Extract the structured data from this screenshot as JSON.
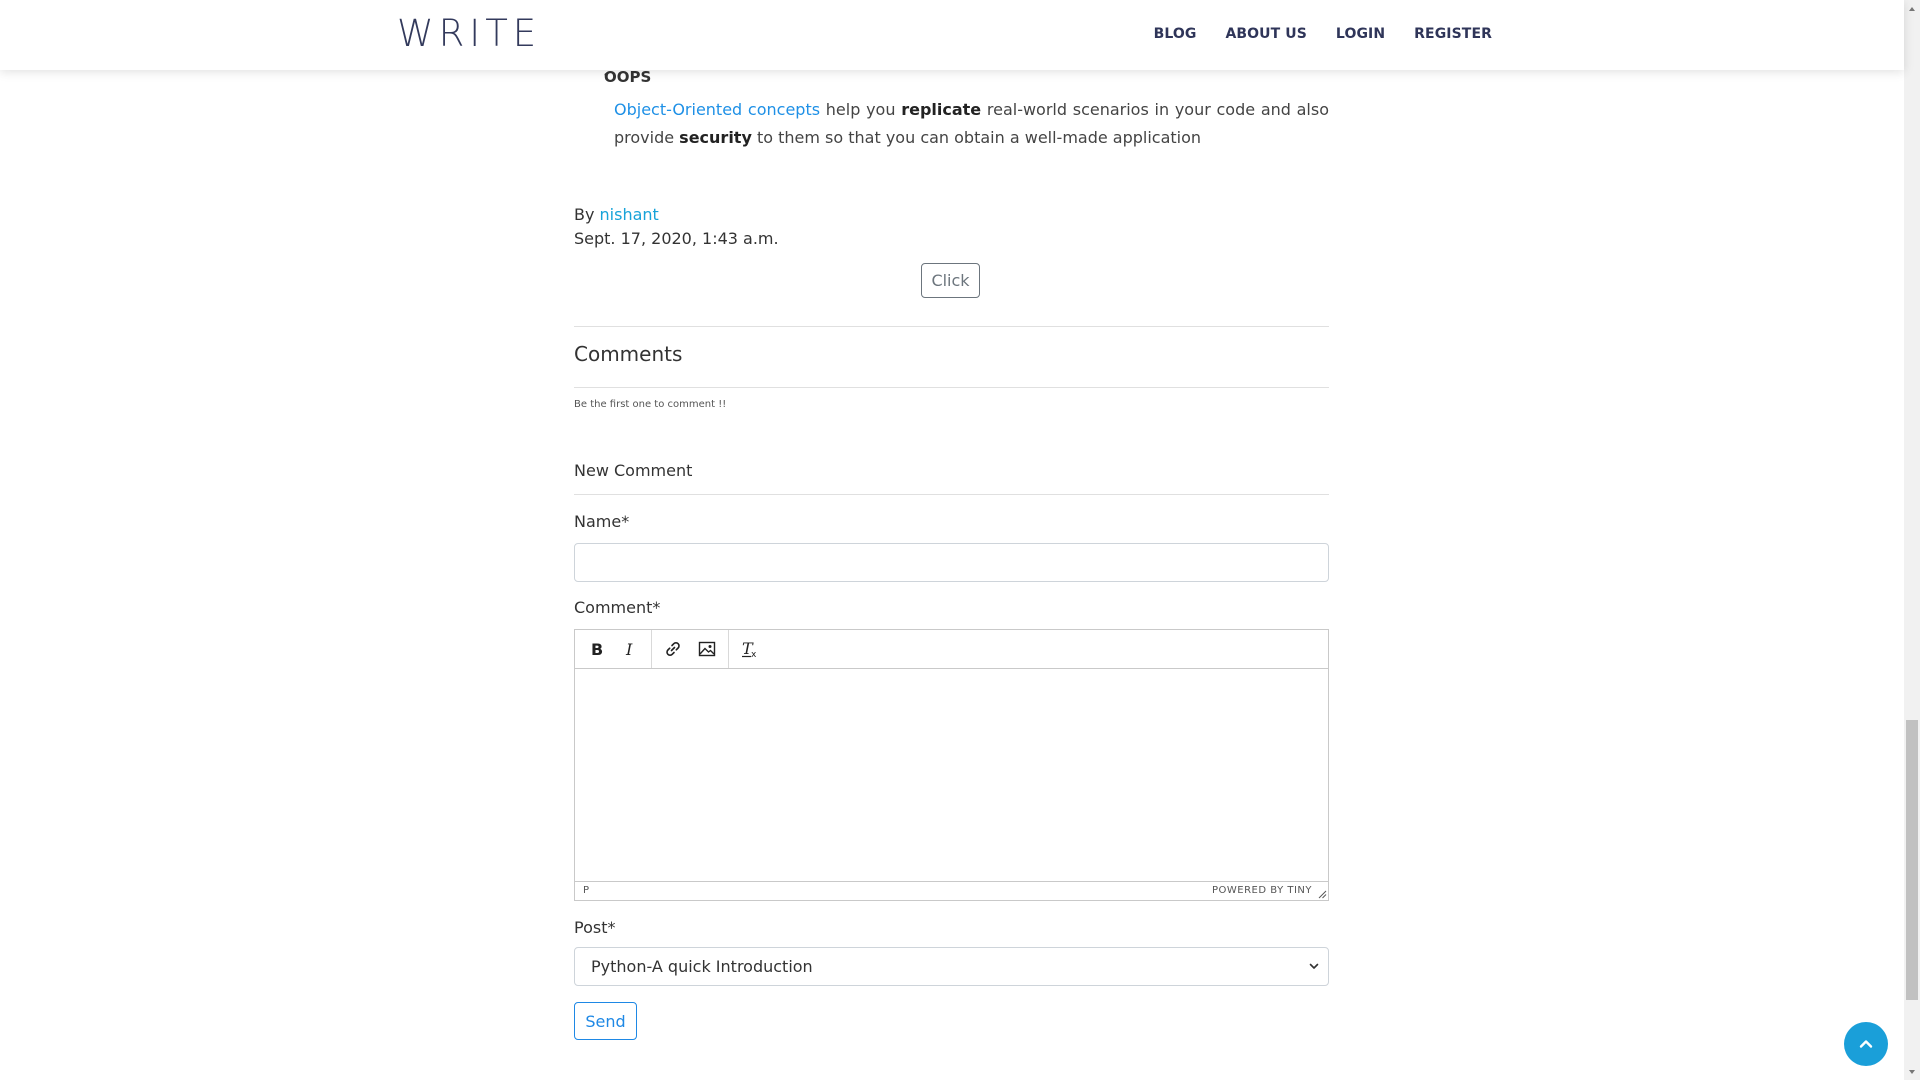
{
  "header": {
    "logo": "WRITE",
    "nav": [
      "BLOG",
      "ABOUT US",
      "LOGIN",
      "REGISTER"
    ]
  },
  "article": {
    "bullet_title": "OOPS",
    "bullet_link": "Object-Oriented concepts",
    "bullet_text_1": " help you ",
    "bullet_bold_1": "replicate",
    "bullet_text_2": " real-world scenarios in your code and also provide ",
    "bullet_bold_2": "security",
    "bullet_text_3": " to them so that you can obtain a well-made application",
    "by_label": "By ",
    "author": "nishant",
    "date": "Sept. 17, 2020, 1:43 a.m.",
    "click_label": "Click"
  },
  "comments": {
    "heading": "Comments",
    "empty_text": "Be the first one to comment !!",
    "new_heading": "New Comment",
    "name_label": "Name*",
    "name_value": "",
    "comment_label": "Comment*",
    "editor_status_tag": "P",
    "editor_powered": "POWERED BY TINY",
    "post_label": "Post*",
    "post_selected": "Python-A quick Introduction",
    "send_label": "Send"
  },
  "icons": {
    "toolbar": [
      "bold-icon",
      "italic-icon",
      "link-icon",
      "image-icon",
      "clear-format-icon"
    ],
    "back_to_top": "chevron-up-icon"
  },
  "colors": {
    "brand": "#333a5c",
    "link": "#1e90e6",
    "accent": "#1a9fd9"
  }
}
